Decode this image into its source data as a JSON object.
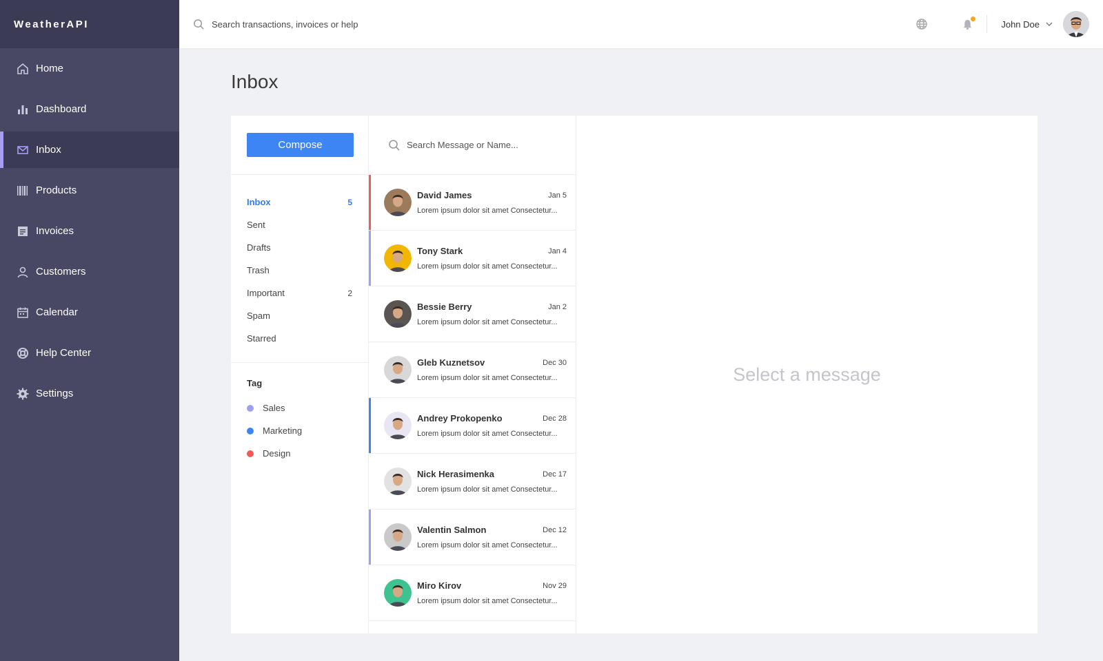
{
  "brand": "WeatherAPI",
  "nav": [
    {
      "label": "Home",
      "icon": "home-icon"
    },
    {
      "label": "Dashboard",
      "icon": "bar-chart-icon"
    },
    {
      "label": "Inbox",
      "icon": "mail-icon",
      "active": true
    },
    {
      "label": "Products",
      "icon": "barcode-icon"
    },
    {
      "label": "Invoices",
      "icon": "receipt-icon"
    },
    {
      "label": "Customers",
      "icon": "user-icon"
    },
    {
      "label": "Calendar",
      "icon": "calendar-icon"
    },
    {
      "label": "Help Center",
      "icon": "lifebuoy-icon"
    },
    {
      "label": "Settings",
      "icon": "gear-icon"
    }
  ],
  "topbar": {
    "search_placeholder": "Search transactions, invoices or help",
    "user_name": "John Doe",
    "notification_dot_color": "#f5a623"
  },
  "page": {
    "title": "Inbox"
  },
  "compose_label": "Compose",
  "folders": [
    {
      "label": "Inbox",
      "count": "5",
      "active": true
    },
    {
      "label": "Sent",
      "count": ""
    },
    {
      "label": "Drafts",
      "count": ""
    },
    {
      "label": "Trash",
      "count": ""
    },
    {
      "label": "Important",
      "count": "2"
    },
    {
      "label": "Spam",
      "count": ""
    },
    {
      "label": "Starred",
      "count": ""
    }
  ],
  "tags": {
    "title": "Tag",
    "items": [
      {
        "label": "Sales",
        "color": "#a0a0f0"
      },
      {
        "label": "Marketing",
        "color": "#3d85f5"
      },
      {
        "label": "Design",
        "color": "#f05a5a"
      }
    ]
  },
  "message_search_placeholder": "Search Message or Name...",
  "messages": [
    {
      "name": "David James",
      "date": "Jan 5",
      "preview": "Lorem ipsum dolor sit amet Consectetur...",
      "bar": "#f05a5a",
      "avatar_bg": "#9c7a5c"
    },
    {
      "name": "Tony Stark",
      "date": "Jan 4",
      "preview": "Lorem ipsum dolor sit amet Consectetur...",
      "bar": "#a0a0f0",
      "avatar_bg": "#f2b705"
    },
    {
      "name": "Bessie Berry",
      "date": "Jan 2",
      "preview": "Lorem ipsum dolor sit amet Consectetur...",
      "bar": "",
      "avatar_bg": "#5a5550"
    },
    {
      "name": "Gleb Kuznetsov",
      "date": "Dec 30",
      "preview": "Lorem ipsum dolor sit amet Consectetur...",
      "bar": "",
      "avatar_bg": "#d8d8d8"
    },
    {
      "name": "Andrey Prokopenko",
      "date": "Dec 28",
      "preview": "Lorem ipsum dolor sit amet Consectetur...",
      "bar": "#3d85f5",
      "avatar_bg": "#e8e6f2"
    },
    {
      "name": "Nick Herasimenka",
      "date": "Dec 17",
      "preview": "Lorem ipsum dolor sit amet Consectetur...",
      "bar": "",
      "avatar_bg": "#e2e2e2"
    },
    {
      "name": "Valentin Salmon",
      "date": "Dec 12",
      "preview": "Lorem ipsum dolor sit amet Consectetur...",
      "bar": "#a0a0f0",
      "avatar_bg": "#c9c9c9"
    },
    {
      "name": "Miro Kirov",
      "date": "Nov 29",
      "preview": "Lorem ipsum dolor sit amet Consectetur...",
      "bar": "",
      "avatar_bg": "#3ec28f"
    }
  ],
  "reader": {
    "empty_text": "Select a message"
  }
}
